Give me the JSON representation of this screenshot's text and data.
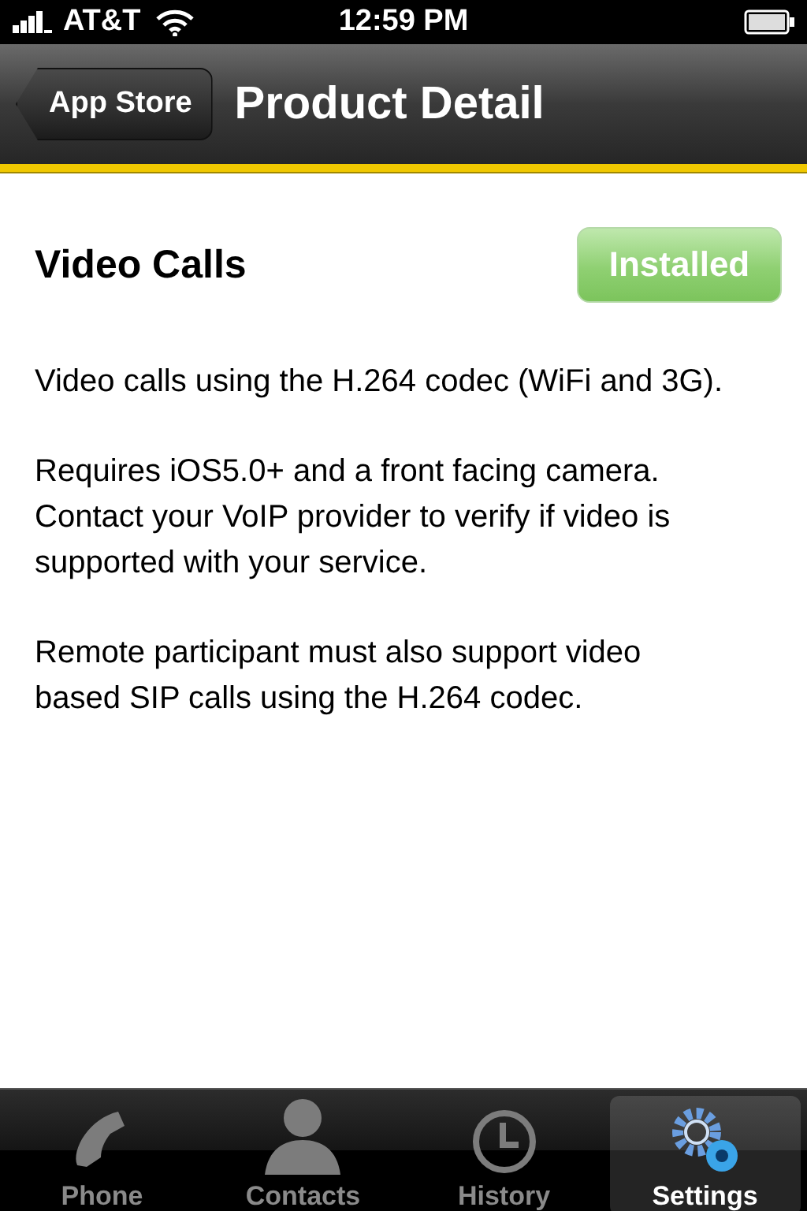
{
  "status_bar": {
    "carrier": "AT&T",
    "time": "12:59 PM"
  },
  "nav_bar": {
    "back_button": "App Store",
    "title": "Product Detail"
  },
  "product": {
    "name": "Video Calls",
    "status_button": {
      "label": "Installed",
      "disabled": true
    }
  },
  "description": [
    "Video calls using the H.264 codec (WiFi and 3G).",
    "Requires iOS5.0+ and a front facing camera. Contact your VoIP provider to verify if video is supported with your service.",
    "Remote participant must also support video based SIP calls using the H.264 codec."
  ],
  "tab_bar": [
    {
      "kind": "phone",
      "label": "Phone",
      "selected": false
    },
    {
      "kind": "contacts",
      "label": "Contacts",
      "selected": false
    },
    {
      "kind": "history",
      "label": "History",
      "selected": false
    },
    {
      "kind": "settings",
      "label": "Settings",
      "selected": true
    }
  ]
}
